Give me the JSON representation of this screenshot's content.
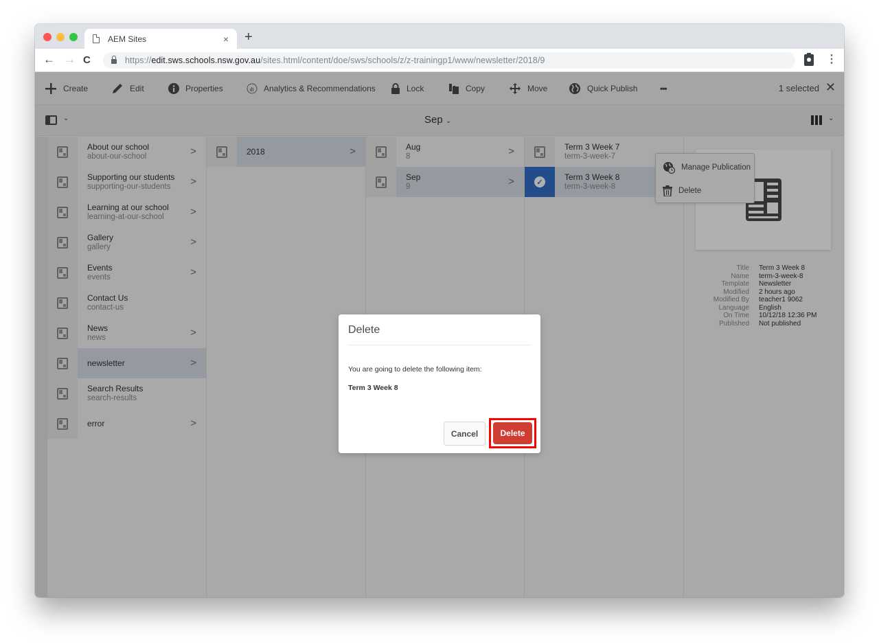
{
  "browser": {
    "tab_title": "AEM Sites",
    "tab_close": "×",
    "new_tab": "+",
    "url_scheme": "https://",
    "url_host": "edit.sws.schools.nsw.gov.au",
    "url_path": "/sites.html/content/doe/sws/schools/z/z-trainingp1/www/newsletter/2018/9"
  },
  "actionbar": {
    "create": "Create",
    "edit": "Edit",
    "properties": "Properties",
    "analytics": "Analytics & Recommendations",
    "lock": "Lock",
    "copy": "Copy",
    "move": "Move",
    "quick_publish": "Quick Publish",
    "more": "•••",
    "selected_count": "1 selected",
    "close": "✕"
  },
  "titlebar": {
    "title": "Sep",
    "chevron": "⌄"
  },
  "more_menu": {
    "items": [
      {
        "label": "Manage Publication",
        "icon": "globe-clock-icon"
      },
      {
        "label": "Delete",
        "icon": "trash-icon"
      }
    ]
  },
  "columns": [
    {
      "items": [
        {
          "title": "About our school",
          "sub": "about-our-school",
          "has_children": true
        },
        {
          "title": "Supporting our students",
          "sub": "supporting-our-students",
          "has_children": true
        },
        {
          "title": "Learning at our school",
          "sub": "learning-at-our-school",
          "has_children": true
        },
        {
          "title": "Gallery",
          "sub": "gallery",
          "has_children": true
        },
        {
          "title": "Events",
          "sub": "events",
          "has_children": true
        },
        {
          "title": "Contact Us",
          "sub": "contact-us",
          "has_children": false
        },
        {
          "title": "News",
          "sub": "news",
          "has_children": true
        },
        {
          "title": "newsletter",
          "sub": "",
          "has_children": true,
          "active": true
        },
        {
          "title": "Search Results",
          "sub": "search-results",
          "has_children": false
        },
        {
          "title": "error",
          "sub": "",
          "has_children": true
        }
      ]
    },
    {
      "items": [
        {
          "title": "2018",
          "sub": "",
          "has_children": true,
          "active": true
        }
      ]
    },
    {
      "items": [
        {
          "title": "Aug",
          "sub": "8",
          "has_children": true
        },
        {
          "title": "Sep",
          "sub": "9",
          "has_children": true,
          "active": true
        }
      ]
    },
    {
      "items": [
        {
          "title": "Term 3 Week 7",
          "sub": "term-3-week-7",
          "has_children": false
        },
        {
          "title": "Term 3 Week 8",
          "sub": "term-3-week-8",
          "has_children": false,
          "active": true,
          "selected": true
        }
      ]
    }
  ],
  "arrow_glyph": ">",
  "check_glyph": "✓",
  "preview": {
    "meta": [
      {
        "key": "Title",
        "value": "Term 3 Week 8"
      },
      {
        "key": "Name",
        "value": "term-3-week-8"
      },
      {
        "key": "Template",
        "value": "Newsletter"
      },
      {
        "key": "Modified",
        "value": "2 hours ago"
      },
      {
        "key": "Modified By",
        "value": "teacher1 9062"
      },
      {
        "key": "Language",
        "value": "English"
      },
      {
        "key": "On Time",
        "value": "10/12/18 12:36 PM"
      },
      {
        "key": "Published",
        "value": "Not published"
      }
    ]
  },
  "dialog": {
    "title": "Delete",
    "message": "You are going to delete the following item:",
    "item": "Term 3 Week 8",
    "cancel": "Cancel",
    "confirm": "Delete"
  },
  "colors": {
    "delete_button": "#d03d33",
    "highlight_box": "#ff0000",
    "selection_blue": "#326ec8"
  }
}
